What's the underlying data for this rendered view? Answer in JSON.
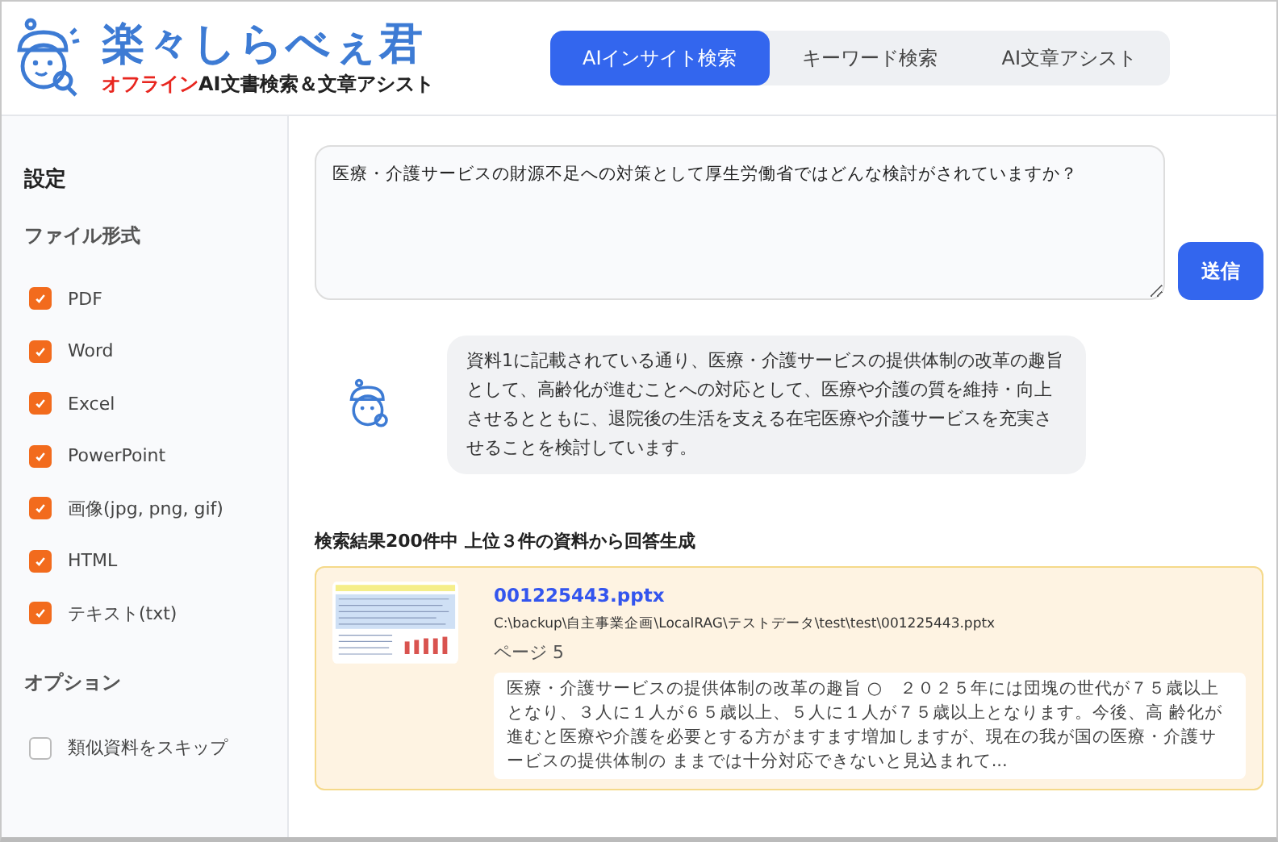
{
  "app": {
    "title": "楽々しらべぇ君",
    "subtitle_highlight": "オフライン",
    "subtitle_rest": "AI文書検索＆文章アシスト"
  },
  "tabs": [
    {
      "label": "AIインサイト検索",
      "selected": true
    },
    {
      "label": "キーワード検索",
      "selected": false
    },
    {
      "label": "AI文章アシスト",
      "selected": false
    }
  ],
  "sidebar": {
    "title": "設定",
    "file_types_heading": "ファイル形式",
    "file_types": [
      {
        "label": "PDF",
        "checked": true
      },
      {
        "label": "Word",
        "checked": true
      },
      {
        "label": "Excel",
        "checked": true
      },
      {
        "label": "PowerPoint",
        "checked": true
      },
      {
        "label": "画像(jpg, png, gif)",
        "checked": true
      },
      {
        "label": "HTML",
        "checked": true
      },
      {
        "label": "テキスト(txt)",
        "checked": true
      }
    ],
    "options_heading": "オプション",
    "options": [
      {
        "label": "類似資料をスキップ",
        "checked": false
      }
    ]
  },
  "question": {
    "value": "医療・介護サービスの財源不足への対策として厚生労働省ではどんな検討がされていますか？"
  },
  "send_button": "送信",
  "answer": "資料1に記載されている通り、医療・介護サービスの提供体制の改革の趣旨として、高齢化が進むことへの対応として、医療や介護の質を維持・向上させるとともに、退院後の生活を支える在宅医療や介護サービスを充実させることを検討しています。",
  "results_heading": "検索結果200件中 上位３件の資料から回答生成",
  "results": [
    {
      "file": "001225443.pptx",
      "path": "C:\\backup\\自主事業企画\\LocalRAG\\テストデータ\\test\\test\\001225443.pptx",
      "page": "ページ 5",
      "excerpt": "医療・介護サービスの提供体制の改革の趣旨 ○　２０２５年には団塊の世代が７５歳以上となり、３人に１人が６５歳以上、５人に１人が７５歳以上となります。今後、高 齢化が進むと医療や介護を必要とする方がますます増加しますが、現在の我が国の医療・介護サービスの提供体制の ままでは十分対応できないと見込まれて..."
    }
  ]
}
